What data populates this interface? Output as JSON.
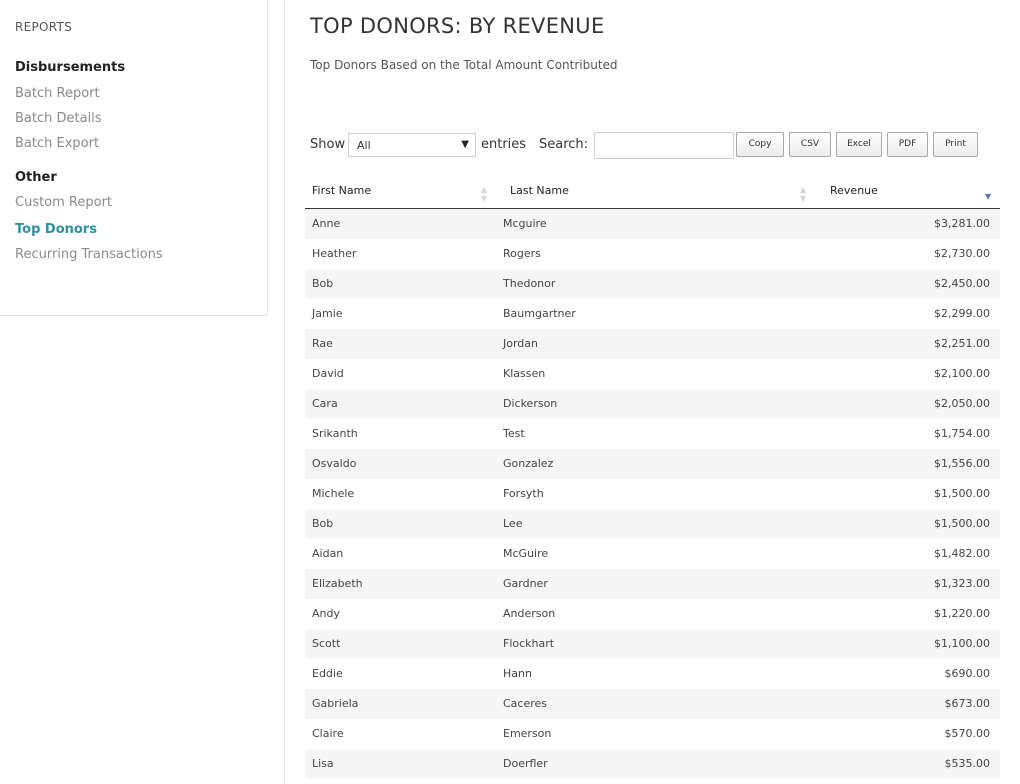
{
  "sidebar": {
    "heading": "REPORTS",
    "groups": [
      {
        "title": "Disbursements",
        "items": [
          "Batch Report",
          "Batch Details",
          "Batch Export"
        ]
      },
      {
        "title": "Other",
        "items": [
          "Custom Report",
          "Top Donors",
          "Recurring Transactions"
        ]
      }
    ],
    "active_item": "Top Donors",
    "active_color": "#2e8fa3"
  },
  "page": {
    "title": "TOP DONORS: BY REVENUE",
    "subtitle": "Top Donors Based on the Total Amount Contributed"
  },
  "controls": {
    "show_label": "Show",
    "entries_value": "All",
    "entries_label": "entries",
    "search_label": "Search:",
    "search_value": "",
    "buttons": [
      "Copy",
      "CSV",
      "Excel",
      "PDF",
      "Print"
    ]
  },
  "table": {
    "columns": [
      "First Name",
      "Last Name",
      "Revenue"
    ],
    "sorted_column": "Revenue",
    "sort_direction": "descending",
    "rows": [
      [
        "Anne",
        "Mcguire",
        "$3,281.00"
      ],
      [
        "Heather",
        "Rogers",
        "$2,730.00"
      ],
      [
        "Bob",
        "Thedonor",
        "$2,450.00"
      ],
      [
        "Jamie",
        "Baumgartner",
        "$2,299.00"
      ],
      [
        "Rae",
        "Jordan",
        "$2,251.00"
      ],
      [
        "David",
        "Klassen",
        "$2,100.00"
      ],
      [
        "Cara",
        "Dickerson",
        "$2,050.00"
      ],
      [
        "Srikanth",
        "Test",
        "$1,754.00"
      ],
      [
        "Osvaldo",
        "Gonzalez",
        "$1,556.00"
      ],
      [
        "Michele",
        "Forsyth",
        "$1,500.00"
      ],
      [
        "Bob",
        "Lee",
        "$1,500.00"
      ],
      [
        "Aidan",
        "McGuire",
        "$1,482.00"
      ],
      [
        "Elizabeth",
        "Gardner",
        "$1,323.00"
      ],
      [
        "Andy",
        "Anderson",
        "$1,220.00"
      ],
      [
        "Scott",
        "Flockhart",
        "$1,100.00"
      ],
      [
        "Eddie",
        "Hann",
        "$690.00"
      ],
      [
        "Gabriela",
        "Caceres",
        "$673.00"
      ],
      [
        "Claire",
        "Emerson",
        "$570.00"
      ],
      [
        "Lisa",
        "Doerfler",
        "$535.00"
      ]
    ]
  }
}
